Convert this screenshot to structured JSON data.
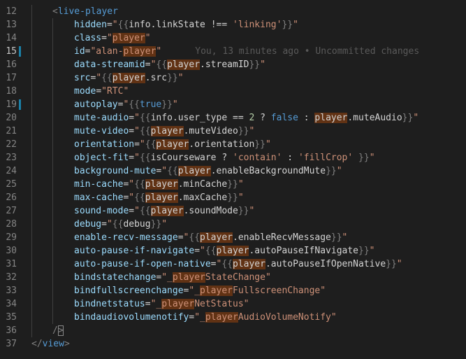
{
  "editor": {
    "blame": "You, 13 minutes ago • Uncommitted changes",
    "lines": [
      {
        "n": "12",
        "tokens": [
          [
            "punct",
            "<"
          ],
          [
            "tag",
            "live-player"
          ]
        ]
      },
      {
        "n": "13",
        "tokens": [
          [
            "attr",
            "hidden"
          ],
          [
            "op",
            "="
          ],
          [
            "str",
            "\""
          ],
          [
            "punct",
            "{{"
          ],
          [
            "var",
            "info.linkState "
          ],
          [
            "op",
            "!=="
          ],
          [
            "str",
            " 'linking'"
          ],
          [
            "punct",
            "}}"
          ],
          [
            "str",
            "\""
          ]
        ]
      },
      {
        "n": "14",
        "tokens": [
          [
            "attr",
            "class"
          ],
          [
            "op",
            "="
          ],
          [
            "str",
            "\""
          ],
          [
            "strhl",
            "player"
          ],
          [
            "str",
            "\""
          ]
        ]
      },
      {
        "n": "15",
        "tokens": [
          [
            "attr",
            "id"
          ],
          [
            "op",
            "="
          ],
          [
            "str",
            "\"alan-"
          ],
          [
            "strhl",
            "player"
          ],
          [
            "str",
            "\""
          ]
        ]
      },
      {
        "n": "16",
        "tokens": [
          [
            "attr",
            "data-streamid"
          ],
          [
            "op",
            "="
          ],
          [
            "str",
            "\""
          ],
          [
            "punct",
            "{{"
          ],
          [
            "varhl",
            "player"
          ],
          [
            "var",
            ".streamID"
          ],
          [
            "punct",
            "}}"
          ],
          [
            "str",
            "\""
          ]
        ]
      },
      {
        "n": "17",
        "tokens": [
          [
            "attr",
            "src"
          ],
          [
            "op",
            "="
          ],
          [
            "str",
            "\""
          ],
          [
            "punct",
            "{{"
          ],
          [
            "varhl",
            "player"
          ],
          [
            "var",
            ".src"
          ],
          [
            "punct",
            "}}"
          ],
          [
            "str",
            "\""
          ]
        ]
      },
      {
        "n": "18",
        "tokens": [
          [
            "attr",
            "mode"
          ],
          [
            "op",
            "="
          ],
          [
            "str",
            "\"RTC\""
          ]
        ]
      },
      {
        "n": "19",
        "tokens": [
          [
            "attr",
            "autoplay"
          ],
          [
            "op",
            "="
          ],
          [
            "str",
            "\""
          ],
          [
            "punct",
            "{{"
          ],
          [
            "kw",
            "true"
          ],
          [
            "punct",
            "}}"
          ],
          [
            "str",
            "\""
          ]
        ]
      },
      {
        "n": "20",
        "tokens": [
          [
            "attr",
            "mute-audio"
          ],
          [
            "op",
            "="
          ],
          [
            "str",
            "\""
          ],
          [
            "punct",
            "{{"
          ],
          [
            "var",
            "info.user_type "
          ],
          [
            "op",
            "=="
          ],
          [
            "var",
            " "
          ],
          [
            "num",
            "2"
          ],
          [
            "var",
            " ? "
          ],
          [
            "kw",
            "false"
          ],
          [
            "var",
            " : "
          ],
          [
            "varhl",
            "player"
          ],
          [
            "var",
            ".muteAudio"
          ],
          [
            "punct",
            "}}"
          ],
          [
            "str",
            "\""
          ]
        ]
      },
      {
        "n": "21",
        "tokens": [
          [
            "attr",
            "mute-video"
          ],
          [
            "op",
            "="
          ],
          [
            "str",
            "\""
          ],
          [
            "punct",
            "{{"
          ],
          [
            "varhl",
            "player"
          ],
          [
            "var",
            ".muteVideo"
          ],
          [
            "punct",
            "}}"
          ],
          [
            "str",
            "\""
          ]
        ]
      },
      {
        "n": "22",
        "tokens": [
          [
            "attr",
            "orientation"
          ],
          [
            "op",
            "="
          ],
          [
            "str",
            "\""
          ],
          [
            "punct",
            "{{"
          ],
          [
            "varhl",
            "player"
          ],
          [
            "var",
            ".orientation"
          ],
          [
            "punct",
            "}}"
          ],
          [
            "str",
            "\""
          ]
        ]
      },
      {
        "n": "23",
        "tokens": [
          [
            "attr",
            "object-fit"
          ],
          [
            "op",
            "="
          ],
          [
            "str",
            "\""
          ],
          [
            "punct",
            "{{"
          ],
          [
            "var",
            "isCourseware ? "
          ],
          [
            "str",
            "'contain'"
          ],
          [
            "var",
            " : "
          ],
          [
            "str",
            "'fillCrop'"
          ],
          [
            "var",
            " "
          ],
          [
            "punct",
            "}}"
          ],
          [
            "str",
            "\""
          ]
        ]
      },
      {
        "n": "24",
        "tokens": [
          [
            "attr",
            "background-mute"
          ],
          [
            "op",
            "="
          ],
          [
            "str",
            "\""
          ],
          [
            "punct",
            "{{"
          ],
          [
            "varhl",
            "player"
          ],
          [
            "var",
            ".enableBackgroundMute"
          ],
          [
            "punct",
            "}}"
          ],
          [
            "str",
            "\""
          ]
        ]
      },
      {
        "n": "25",
        "tokens": [
          [
            "attr",
            "min-cache"
          ],
          [
            "op",
            "="
          ],
          [
            "str",
            "\""
          ],
          [
            "punct",
            "{{"
          ],
          [
            "varhl",
            "player"
          ],
          [
            "var",
            ".minCache"
          ],
          [
            "punct",
            "}}"
          ],
          [
            "str",
            "\""
          ]
        ]
      },
      {
        "n": "26",
        "tokens": [
          [
            "attr",
            "max-cache"
          ],
          [
            "op",
            "="
          ],
          [
            "str",
            "\""
          ],
          [
            "punct",
            "{{"
          ],
          [
            "varhl",
            "player"
          ],
          [
            "var",
            ".maxCache"
          ],
          [
            "punct",
            "}}"
          ],
          [
            "str",
            "\""
          ]
        ]
      },
      {
        "n": "27",
        "tokens": [
          [
            "attr",
            "sound-mode"
          ],
          [
            "op",
            "="
          ],
          [
            "str",
            "\""
          ],
          [
            "punct",
            "{{"
          ],
          [
            "varhl",
            "player"
          ],
          [
            "var",
            ".soundMode"
          ],
          [
            "punct",
            "}}"
          ],
          [
            "str",
            "\""
          ]
        ]
      },
      {
        "n": "28",
        "tokens": [
          [
            "attr",
            "debug"
          ],
          [
            "op",
            "="
          ],
          [
            "str",
            "\""
          ],
          [
            "punct",
            "{{"
          ],
          [
            "var",
            "debug"
          ],
          [
            "punct",
            "}}"
          ],
          [
            "str",
            "\""
          ]
        ]
      },
      {
        "n": "29",
        "tokens": [
          [
            "attr",
            "enable-recv-message"
          ],
          [
            "op",
            "="
          ],
          [
            "str",
            "\""
          ],
          [
            "punct",
            "{{"
          ],
          [
            "varhl",
            "player"
          ],
          [
            "var",
            ".enableRecvMessage"
          ],
          [
            "punct",
            "}}"
          ],
          [
            "str",
            "\""
          ]
        ]
      },
      {
        "n": "30",
        "tokens": [
          [
            "attr",
            "auto-pause-if-navigate"
          ],
          [
            "op",
            "="
          ],
          [
            "str",
            "\""
          ],
          [
            "punct",
            "{{"
          ],
          [
            "varhl",
            "player"
          ],
          [
            "var",
            ".autoPauseIfNavigate"
          ],
          [
            "punct",
            "}}"
          ],
          [
            "str",
            "\""
          ]
        ]
      },
      {
        "n": "31",
        "tokens": [
          [
            "attr",
            "auto-pause-if-open-native"
          ],
          [
            "op",
            "="
          ],
          [
            "str",
            "\""
          ],
          [
            "punct",
            "{{"
          ],
          [
            "varhl",
            "player"
          ],
          [
            "var",
            ".autoPauseIfOpenNative"
          ],
          [
            "punct",
            "}}"
          ],
          [
            "str",
            "\""
          ]
        ]
      },
      {
        "n": "32",
        "tokens": [
          [
            "attr",
            "bindstatechange"
          ],
          [
            "op",
            "="
          ],
          [
            "str",
            "\"_"
          ],
          [
            "strhl",
            "player"
          ],
          [
            "str",
            "StateChange\""
          ]
        ]
      },
      {
        "n": "33",
        "tokens": [
          [
            "attr",
            "bindfullscreenchange"
          ],
          [
            "op",
            "="
          ],
          [
            "str",
            "\"_"
          ],
          [
            "strhl",
            "player"
          ],
          [
            "str",
            "FullscreenChange\""
          ]
        ]
      },
      {
        "n": "34",
        "tokens": [
          [
            "attr",
            "bindnetstatus"
          ],
          [
            "op",
            "="
          ],
          [
            "str",
            "\"_"
          ],
          [
            "strhl",
            "player"
          ],
          [
            "str",
            "NetStatus\""
          ]
        ]
      },
      {
        "n": "35",
        "tokens": [
          [
            "attr",
            "bindaudiovolumenotify"
          ],
          [
            "op",
            "="
          ],
          [
            "str",
            "\"_"
          ],
          [
            "strhl",
            "player"
          ],
          [
            "str",
            "AudioVolumeNotify\""
          ]
        ]
      },
      {
        "n": "36",
        "tokens": [
          [
            "punct",
            "/"
          ],
          [
            "bracket",
            ">"
          ]
        ]
      },
      {
        "n": "37",
        "tokens": [
          [
            "punct",
            "</"
          ],
          [
            "tag",
            "view"
          ],
          [
            "punct",
            ">"
          ]
        ]
      }
    ]
  }
}
